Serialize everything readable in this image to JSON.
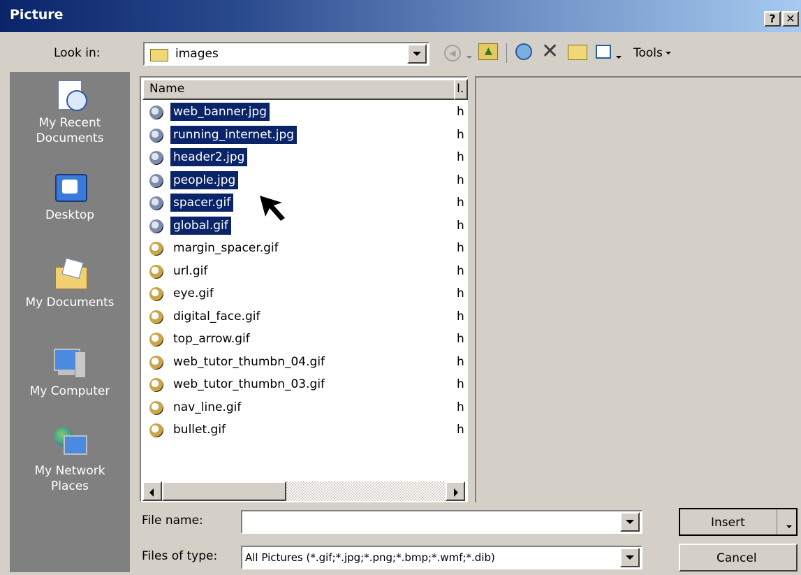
{
  "window": {
    "title": "Picture",
    "help_glyph": "?",
    "close_glyph": "✕"
  },
  "look_in": {
    "label": "Look in:",
    "value": "images",
    "tools_label": "Tools"
  },
  "places": [
    {
      "label_line1": "My Recent",
      "label_line2": "Documents",
      "icon": "recent-documents-icon"
    },
    {
      "label_line1": "Desktop",
      "label_line2": "",
      "icon": "desktop-icon"
    },
    {
      "label_line1": "My Documents",
      "label_line2": "",
      "icon": "my-documents-icon"
    },
    {
      "label_line1": "My Computer",
      "label_line2": "",
      "icon": "my-computer-icon"
    },
    {
      "label_line1": "My Network",
      "label_line2": "Places",
      "icon": "network-places-icon"
    }
  ],
  "list": {
    "col_name": "Name",
    "col_short": "I.",
    "files": [
      {
        "name": "web_banner.jpg",
        "attr": "h",
        "selected": true
      },
      {
        "name": "running_internet.jpg",
        "attr": "h",
        "selected": true
      },
      {
        "name": "header2.jpg",
        "attr": "h",
        "selected": true
      },
      {
        "name": "people.jpg",
        "attr": "h",
        "selected": true
      },
      {
        "name": "spacer.gif",
        "attr": "h",
        "selected": true
      },
      {
        "name": "global.gif",
        "attr": "h",
        "selected": true
      },
      {
        "name": "margin_spacer.gif",
        "attr": "h",
        "selected": false
      },
      {
        "name": "url.gif",
        "attr": "h",
        "selected": false
      },
      {
        "name": "eye.gif",
        "attr": "h",
        "selected": false
      },
      {
        "name": "digital_face.gif",
        "attr": "h",
        "selected": false
      },
      {
        "name": "top_arrow.gif",
        "attr": "h",
        "selected": false
      },
      {
        "name": "web_tutor_thumbn_04.gif",
        "attr": "h",
        "selected": false
      },
      {
        "name": "web_tutor_thumbn_03.gif",
        "attr": "h",
        "selected": false
      },
      {
        "name": "nav_line.gif",
        "attr": "h",
        "selected": false
      },
      {
        "name": "bullet.gif",
        "attr": "h",
        "selected": false
      }
    ]
  },
  "file_name": {
    "label": "File name:",
    "value": ""
  },
  "file_type": {
    "label": "Files of type:",
    "value": "All Pictures (*.gif;*.jpg;*.png;*.bmp;*.wmf;*.dib)"
  },
  "buttons": {
    "insert": "Insert",
    "cancel": "Cancel"
  },
  "colors": {
    "title_start": "#0a246a",
    "title_end": "#a6caf0",
    "selection": "#0a246a",
    "face": "#d4d0c8"
  }
}
